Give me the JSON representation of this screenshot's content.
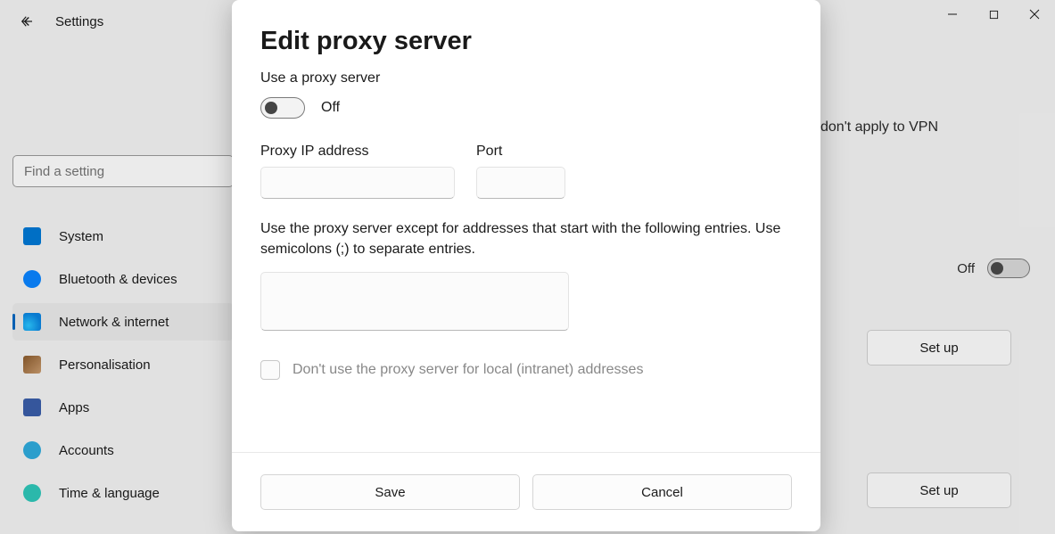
{
  "window": {
    "back_accessible": "Back",
    "title": "Settings",
    "controls": {
      "minimize": "Minimize",
      "maximize": "Maximize",
      "close": "Close"
    }
  },
  "search": {
    "placeholder": "Find a setting"
  },
  "sidebar": {
    "items": [
      {
        "label": "System",
        "icon": "system-icon"
      },
      {
        "label": "Bluetooth & devices",
        "icon": "bluetooth-icon"
      },
      {
        "label": "Network & internet",
        "icon": "network-icon",
        "selected": true
      },
      {
        "label": "Personalisation",
        "icon": "personalisation-icon"
      },
      {
        "label": "Apps",
        "icon": "apps-icon"
      },
      {
        "label": "Accounts",
        "icon": "accounts-icon"
      },
      {
        "label": "Time & language",
        "icon": "time-language-icon"
      }
    ]
  },
  "background": {
    "text_right": "don't apply to VPN",
    "toggle_off": "Off",
    "setup_label": "Set up"
  },
  "dialog": {
    "title": "Edit proxy server",
    "use_proxy_label": "Use a proxy server",
    "toggle_state": "Off",
    "ip_label": "Proxy IP address",
    "ip_value": "",
    "port_label": "Port",
    "port_value": "",
    "exceptions_help": "Use the proxy server except for addresses that start with the following entries. Use semicolons (;) to separate entries.",
    "exceptions_value": "",
    "local_bypass_label": "Don't use the proxy server for local (intranet) addresses",
    "save_label": "Save",
    "cancel_label": "Cancel"
  }
}
